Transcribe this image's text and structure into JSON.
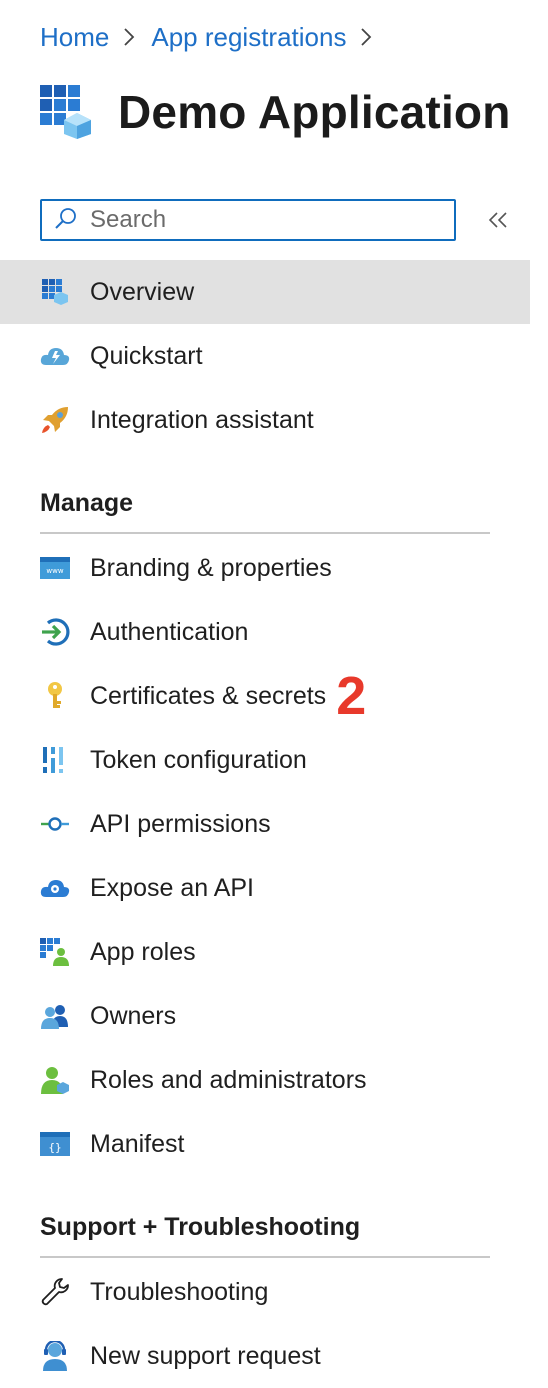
{
  "breadcrumb": {
    "items": [
      "Home",
      "App registrations"
    ]
  },
  "header": {
    "title": "Demo Application",
    "icon": "app-registration-icon"
  },
  "search": {
    "placeholder": "Search",
    "value": ""
  },
  "collapse": {
    "icon": "double-chevron-left-icon"
  },
  "nav": {
    "top_items": [
      {
        "label": "Overview",
        "icon": "overview-icon",
        "selected": true
      },
      {
        "label": "Quickstart",
        "icon": "quickstart-cloud-icon"
      },
      {
        "label": "Integration assistant",
        "icon": "rocket-icon"
      }
    ],
    "manage": {
      "header": "Manage",
      "items": [
        {
          "label": "Branding & properties",
          "icon": "branding-icon"
        },
        {
          "label": "Authentication",
          "icon": "authentication-icon"
        },
        {
          "label": "Certificates & secrets",
          "icon": "key-icon",
          "badge": "2"
        },
        {
          "label": "Token configuration",
          "icon": "token-bars-icon"
        },
        {
          "label": "API permissions",
          "icon": "api-permissions-icon"
        },
        {
          "label": "Expose an API",
          "icon": "cloud-gear-icon"
        },
        {
          "label": "App roles",
          "icon": "app-roles-icon"
        },
        {
          "label": "Owners",
          "icon": "owners-icon"
        },
        {
          "label": "Roles and administrators",
          "icon": "roles-admin-icon"
        },
        {
          "label": "Manifest",
          "icon": "manifest-icon"
        }
      ]
    },
    "support": {
      "header": "Support + Troubleshooting",
      "items": [
        {
          "label": "Troubleshooting",
          "icon": "wrench-icon"
        },
        {
          "label": "New support request",
          "icon": "support-person-icon"
        }
      ]
    }
  },
  "colors": {
    "link": "#1e6fc7",
    "accent": "#0f6cbd",
    "selected_bg": "#e1e1e1",
    "badge": "#e8392b"
  }
}
